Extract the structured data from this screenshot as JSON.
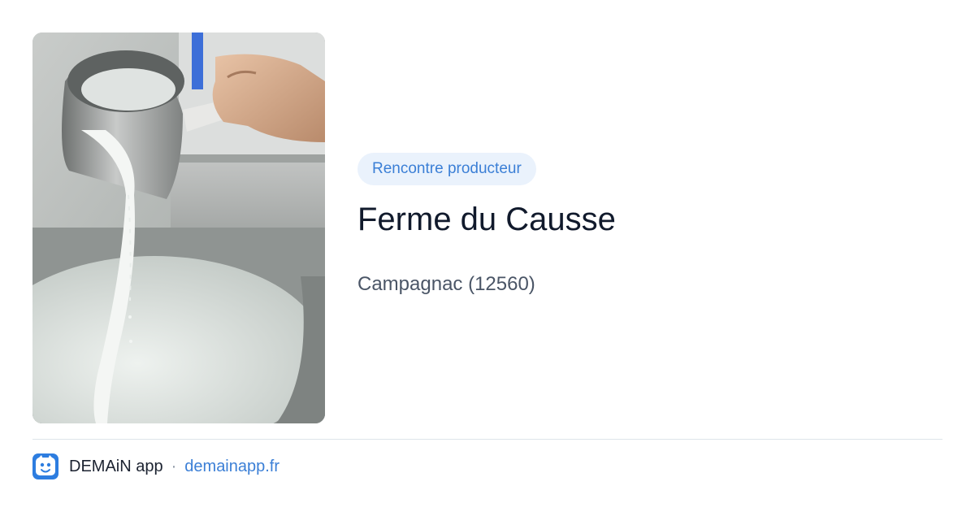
{
  "card": {
    "image": {
      "subject": "milk-pouring-from-steel-pitcher-into-vat"
    },
    "badge": "Rencontre producteur",
    "title": "Ferme du Causse",
    "location": "Campagnac (12560)"
  },
  "footer": {
    "app_name": "DEMAiN app",
    "separator": "·",
    "website": "demainapp.fr",
    "icon": "demain-app-logo-icon"
  },
  "colors": {
    "badge_bg": "#eaf2fc",
    "accent": "#3b7fd6",
    "title": "#111a2c",
    "subtitle": "#4a5566",
    "divider": "#dde5ea",
    "app_icon_bg": "#2d7de0"
  }
}
